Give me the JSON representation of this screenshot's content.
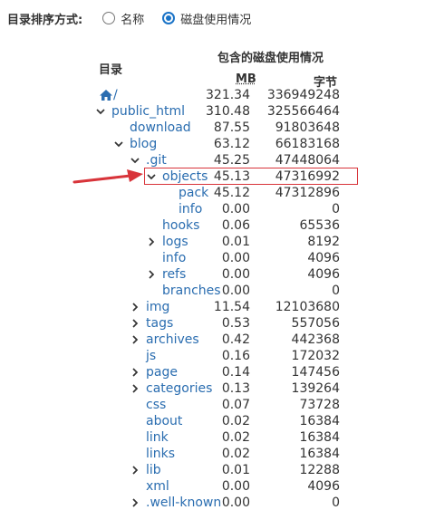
{
  "sort": {
    "label": "目录排序方式:",
    "options": [
      {
        "label": "名称",
        "checked": false
      },
      {
        "label": "磁盘使用情况",
        "checked": true
      }
    ]
  },
  "header": {
    "dir_label": "目录",
    "usage_label": "包含的磁盘使用情况",
    "mb_label": "MB",
    "bytes_label": "字节"
  },
  "rows": [
    {
      "name": "/",
      "icon": "home-icon",
      "depth": 0,
      "chevron": "",
      "mb": "321.34",
      "bytes": "336949248"
    },
    {
      "name": "public_html",
      "depth": 0,
      "chevron": "down",
      "mb": "310.48",
      "bytes": "325566464"
    },
    {
      "name": "download",
      "depth": 1,
      "chevron": "",
      "mb": "87.55",
      "bytes": "91803648"
    },
    {
      "name": "blog",
      "depth": 1,
      "chevron": "down",
      "mb": "63.12",
      "bytes": "66183168"
    },
    {
      "name": ".git",
      "depth": 2,
      "chevron": "down",
      "mb": "45.25",
      "bytes": "47448064"
    },
    {
      "name": "objects",
      "depth": 3,
      "chevron": "down",
      "mb": "45.13",
      "bytes": "47316992",
      "highlighted": true
    },
    {
      "name": "pack",
      "depth": 4,
      "chevron": "",
      "mb": "45.12",
      "bytes": "47312896"
    },
    {
      "name": "info",
      "depth": 4,
      "chevron": "",
      "mb": "0.00",
      "bytes": "0"
    },
    {
      "name": "hooks",
      "depth": 3,
      "chevron": "",
      "mb": "0.06",
      "bytes": "65536"
    },
    {
      "name": "logs",
      "depth": 3,
      "chevron": "right",
      "mb": "0.01",
      "bytes": "8192"
    },
    {
      "name": "info",
      "depth": 3,
      "chevron": "",
      "mb": "0.00",
      "bytes": "4096"
    },
    {
      "name": "refs",
      "depth": 3,
      "chevron": "right",
      "mb": "0.00",
      "bytes": "4096"
    },
    {
      "name": "branches",
      "depth": 3,
      "chevron": "",
      "mb": "0.00",
      "bytes": "0"
    },
    {
      "name": "img",
      "depth": 2,
      "chevron": "right",
      "mb": "11.54",
      "bytes": "12103680"
    },
    {
      "name": "tags",
      "depth": 2,
      "chevron": "right",
      "mb": "0.53",
      "bytes": "557056"
    },
    {
      "name": "archives",
      "depth": 2,
      "chevron": "right",
      "mb": "0.42",
      "bytes": "442368"
    },
    {
      "name": "js",
      "depth": 2,
      "chevron": "",
      "mb": "0.16",
      "bytes": "172032"
    },
    {
      "name": "page",
      "depth": 2,
      "chevron": "right",
      "mb": "0.14",
      "bytes": "147456"
    },
    {
      "name": "categories",
      "depth": 2,
      "chevron": "right",
      "mb": "0.13",
      "bytes": "139264"
    },
    {
      "name": "css",
      "depth": 2,
      "chevron": "",
      "mb": "0.07",
      "bytes": "73728"
    },
    {
      "name": "about",
      "depth": 2,
      "chevron": "",
      "mb": "0.02",
      "bytes": "16384"
    },
    {
      "name": "link",
      "depth": 2,
      "chevron": "",
      "mb": "0.02",
      "bytes": "16384"
    },
    {
      "name": "links",
      "depth": 2,
      "chevron": "",
      "mb": "0.02",
      "bytes": "16384"
    },
    {
      "name": "lib",
      "depth": 2,
      "chevron": "right",
      "mb": "0.01",
      "bytes": "12288"
    },
    {
      "name": "xml",
      "depth": 2,
      "chevron": "",
      "mb": "0.00",
      "bytes": "4096"
    },
    {
      "name": ".well-known",
      "depth": 2,
      "chevron": "right",
      "mb": "0.00",
      "bytes": "0"
    }
  ],
  "colors": {
    "link": "#2a6db0",
    "accent": "#1a73c7",
    "highlight": "#d8343a"
  }
}
